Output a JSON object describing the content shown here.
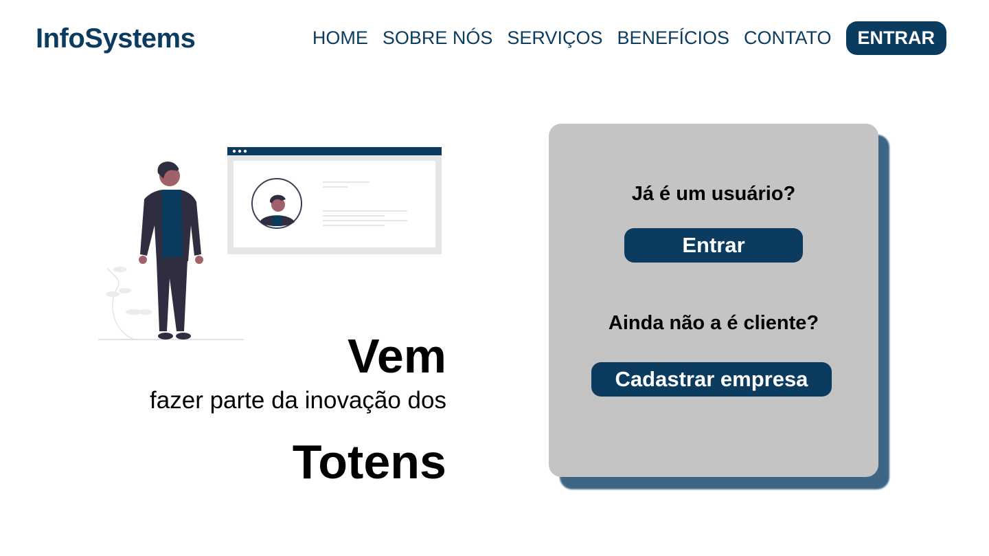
{
  "header": {
    "brand": "InfoSystems",
    "nav": [
      "HOME",
      "SOBRE NÓS",
      "SERVIÇOS",
      "BENEFÍCIOS",
      "CONTATO"
    ],
    "login_button": "ENTRAR"
  },
  "hero": {
    "line1": "Vem",
    "line2": "fazer parte da inovação dos",
    "line3": "Totens"
  },
  "card": {
    "question_user": "Já é um usuário?",
    "enter_button": "Entrar",
    "question_client": "Ainda não a é cliente?",
    "register_button": "Cadastrar empresa"
  },
  "colors": {
    "primary": "#0b3b5e",
    "card_bg": "#c4c4c4",
    "card_shadow": "#3d6585"
  },
  "icons": [
    "person-illustration",
    "browser-window-illustration",
    "profile-avatar-icon",
    "plant-illustration"
  ]
}
